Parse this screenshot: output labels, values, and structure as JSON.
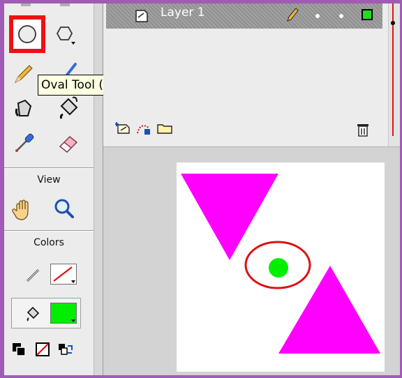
{
  "tooltip": {
    "text": "Oval Tool (O)"
  },
  "tools": {
    "view_label": "View",
    "colors_label": "Colors",
    "items": [
      "oval-tool",
      "polystar-tool",
      "pencil-tool",
      "brush-tool",
      "ink-bottle-tool",
      "paint-bucket-tool",
      "eyedropper-tool",
      "eraser-tool"
    ],
    "view_items": [
      "hand-tool",
      "zoom-tool"
    ]
  },
  "colors": {
    "stroke": "none",
    "fill": "#00ee00",
    "stage_background": "#ffffff",
    "accent_selection": "#ee1111"
  },
  "timeline": {
    "layer_name": "Layer 1",
    "keyframe_color": "#22dd22"
  },
  "stage": {
    "shapes": [
      {
        "type": "triangle-down",
        "color": "#ff00ff"
      },
      {
        "type": "oval-outline",
        "color": "#e01010"
      },
      {
        "type": "dot",
        "color": "#00ee00"
      },
      {
        "type": "triangle-up",
        "color": "#ff00ff"
      }
    ]
  }
}
